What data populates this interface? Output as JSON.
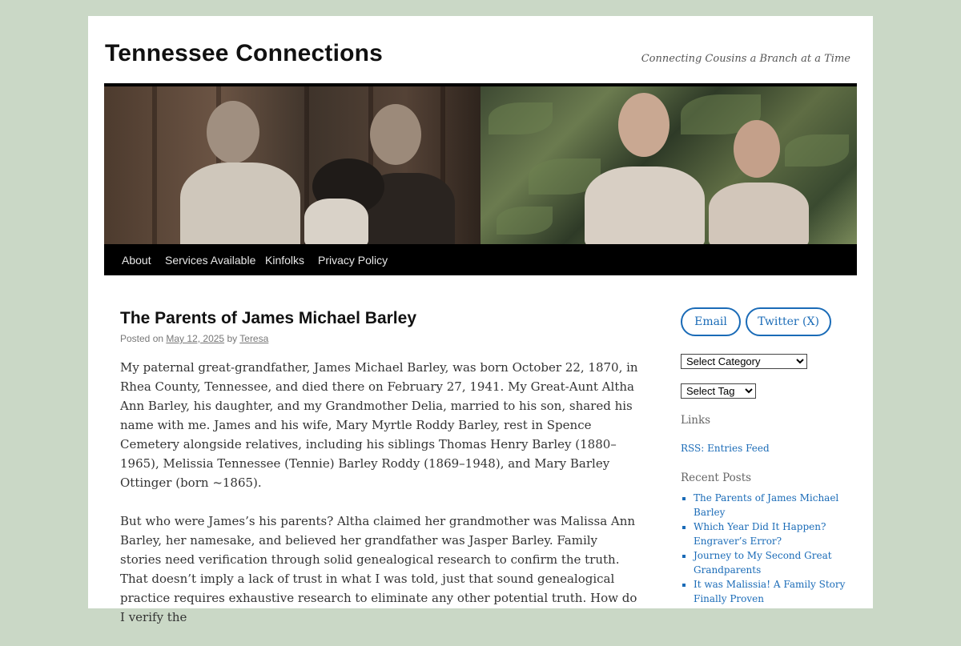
{
  "site": {
    "title": "Tennessee Connections",
    "tagline": "Connecting Cousins a Branch at a Time"
  },
  "nav": {
    "items": [
      {
        "label": "About"
      },
      {
        "label": "Services Available"
      },
      {
        "label": "Kinfolks"
      },
      {
        "label": "Privacy Policy"
      }
    ]
  },
  "post": {
    "title": "The Parents of James Michael Barley",
    "posted_on": "Posted on",
    "date": "May 12, 2025",
    "by": "by",
    "author": "Teresa",
    "paragraphs": [
      "My paternal great-grandfather, James Michael Barley, was born October 22, 1870, in Rhea County, Tennessee, and died there on February 27, 1941. My Great-Aunt Altha Ann Barley, his daughter, and my Grandmother Delia, married to his son, shared his name with me. James and his wife, Mary Myrtle Roddy Barley, rest in Spence Cemetery alongside relatives, including his siblings Thomas Henry Barley (1880–1965), Melissia Tennessee (Tennie) Barley Roddy (1869–1948), and Mary Barley Ottinger (born ~1865).",
      "But who were James’s his parents?  Altha claimed her grandmother was Malissa Ann Barley, her namesake, and believed her grandfather was Jasper Barley. Family stories need verification through solid genealogical research to confirm the truth. That doesn’t imply a lack of trust in what I was told, just that sound genealogical practice requires exhaustive research to eliminate any other potential truth. How do I verify the"
    ]
  },
  "sidebar": {
    "email_label": "Email",
    "twitter_label": "Twitter (X)",
    "category_select": "Select Category",
    "tag_select": "Select Tag",
    "links_title": "Links",
    "rss_link": "RSS: Entries Feed",
    "recent_title": "Recent Posts",
    "recent_posts": [
      {
        "label": "The Parents of James Michael Barley"
      },
      {
        "label": "Which Year Did It Happen? Engraver’s Error?"
      },
      {
        "label": "Journey to My Second Great Grandparents"
      },
      {
        "label": "It was Malissia! A Family Story Finally Proven"
      }
    ]
  },
  "colors": {
    "background": "#cad8c6",
    "link": "#1a6bb7",
    "navbar": "#000000"
  }
}
